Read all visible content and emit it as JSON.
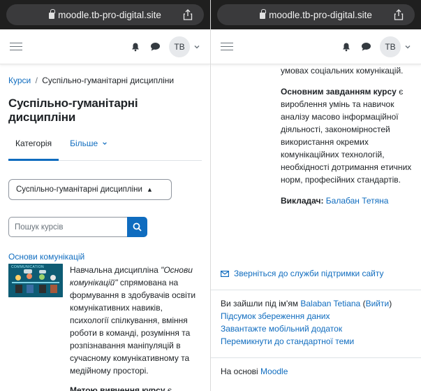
{
  "browser": {
    "left_url": "moodle.tb-pro-digital.site",
    "right_url": "moodle.tb-pro-digital.site"
  },
  "navbar": {
    "avatar_initials": "TB"
  },
  "left": {
    "breadcrumb": [
      "Курси",
      "Суспільно-гуманітарні дисципліни"
    ],
    "breadcrumb_sep": "/",
    "page_title": "Суспільно-гуманітарні дисципліни",
    "tabs": [
      {
        "label": "Категорія"
      },
      {
        "label": "Більше"
      }
    ],
    "category_select": "Суспільно-гуманітарні дисципліни",
    "search_placeholder": "Пошук курсів",
    "course": {
      "title": "Основи комунікацій",
      "image_caption": "COMMUNICATION",
      "desc_prefix": "Навчальна дисципліна ",
      "desc_italic": "\"Основи комунікацій\"",
      "desc_suffix": " спрямована на формування в здобувачів освіти комунікативних навиків, психології спілкування, вміння роботи в команді, розуміння та розпізнавання маніпуляцій в сучасному комунікативному та медійному просторі.",
      "purpose_bold": "Метою вивчення курсу",
      "purpose_rest": " є"
    }
  },
  "right": {
    "top_line": "умовах соціальних комунікацій.",
    "task_bold": "Основним завданням курсу",
    "task_rest": " є вироблення умінь та навичок аналізу масово інформаційної діяльності, закономірностей використання окремих комунікаційних технологій, необхідності дотримання етичних норм, професійних стандартів.",
    "teacher_label": "Викладач:",
    "teacher_name": "Балабан Тетяна",
    "support_link": "Зверніться до служби підтримки сайту",
    "logged_in_prefix": "Ви зайшли під ім'ям ",
    "user_name": "Balaban Tetiana",
    "logout": "Вийти",
    "links": [
      "Підсумок збереження даних",
      "Завантажте мобільний додаток",
      "Перемикнути до стандартної теми"
    ],
    "powered_prefix": "На основі ",
    "powered_link": "Moodle"
  },
  "colors": {
    "link": "#0f6cbf",
    "text": "#1d2125",
    "urlbar_bg": "#3a3a3c"
  }
}
